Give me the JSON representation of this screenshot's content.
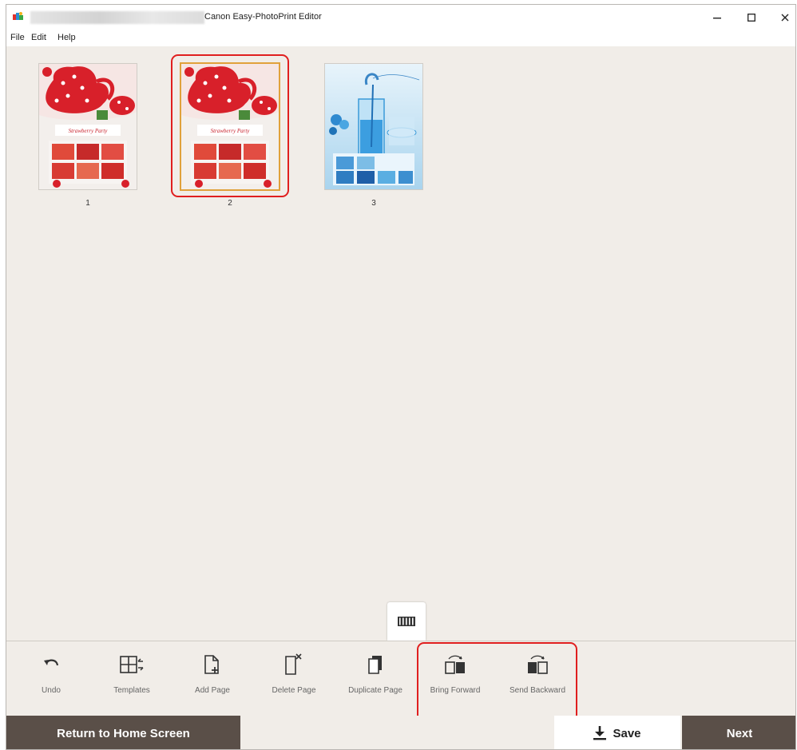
{
  "window": {
    "title": "Canon Easy-PhotoPrint Editor"
  },
  "menu": {
    "items": [
      "File",
      "Edit",
      "Help"
    ]
  },
  "pages": [
    {
      "number": "1",
      "theme": "red-teapot",
      "selected": false
    },
    {
      "number": "2",
      "theme": "red-teapot",
      "selected": true
    },
    {
      "number": "3",
      "theme": "blue-glasses",
      "selected": false
    }
  ],
  "layout_toggle": {
    "icon": "filmstrip-icon"
  },
  "toolbar": {
    "undo": "Undo",
    "templates": "Templates",
    "add_page": "Add Page",
    "delete_page": "Delete Page",
    "duplicate_page": "Duplicate Page",
    "bring_forward": "Bring Forward",
    "send_backward": "Send Backward"
  },
  "bottom": {
    "home": "Return to Home Screen",
    "save": "Save",
    "next": "Next"
  },
  "colors": {
    "background": "#f1ede8",
    "dark_button": "#5a4f48",
    "highlight": "#e01f1f",
    "selection": "#e0a13b"
  }
}
